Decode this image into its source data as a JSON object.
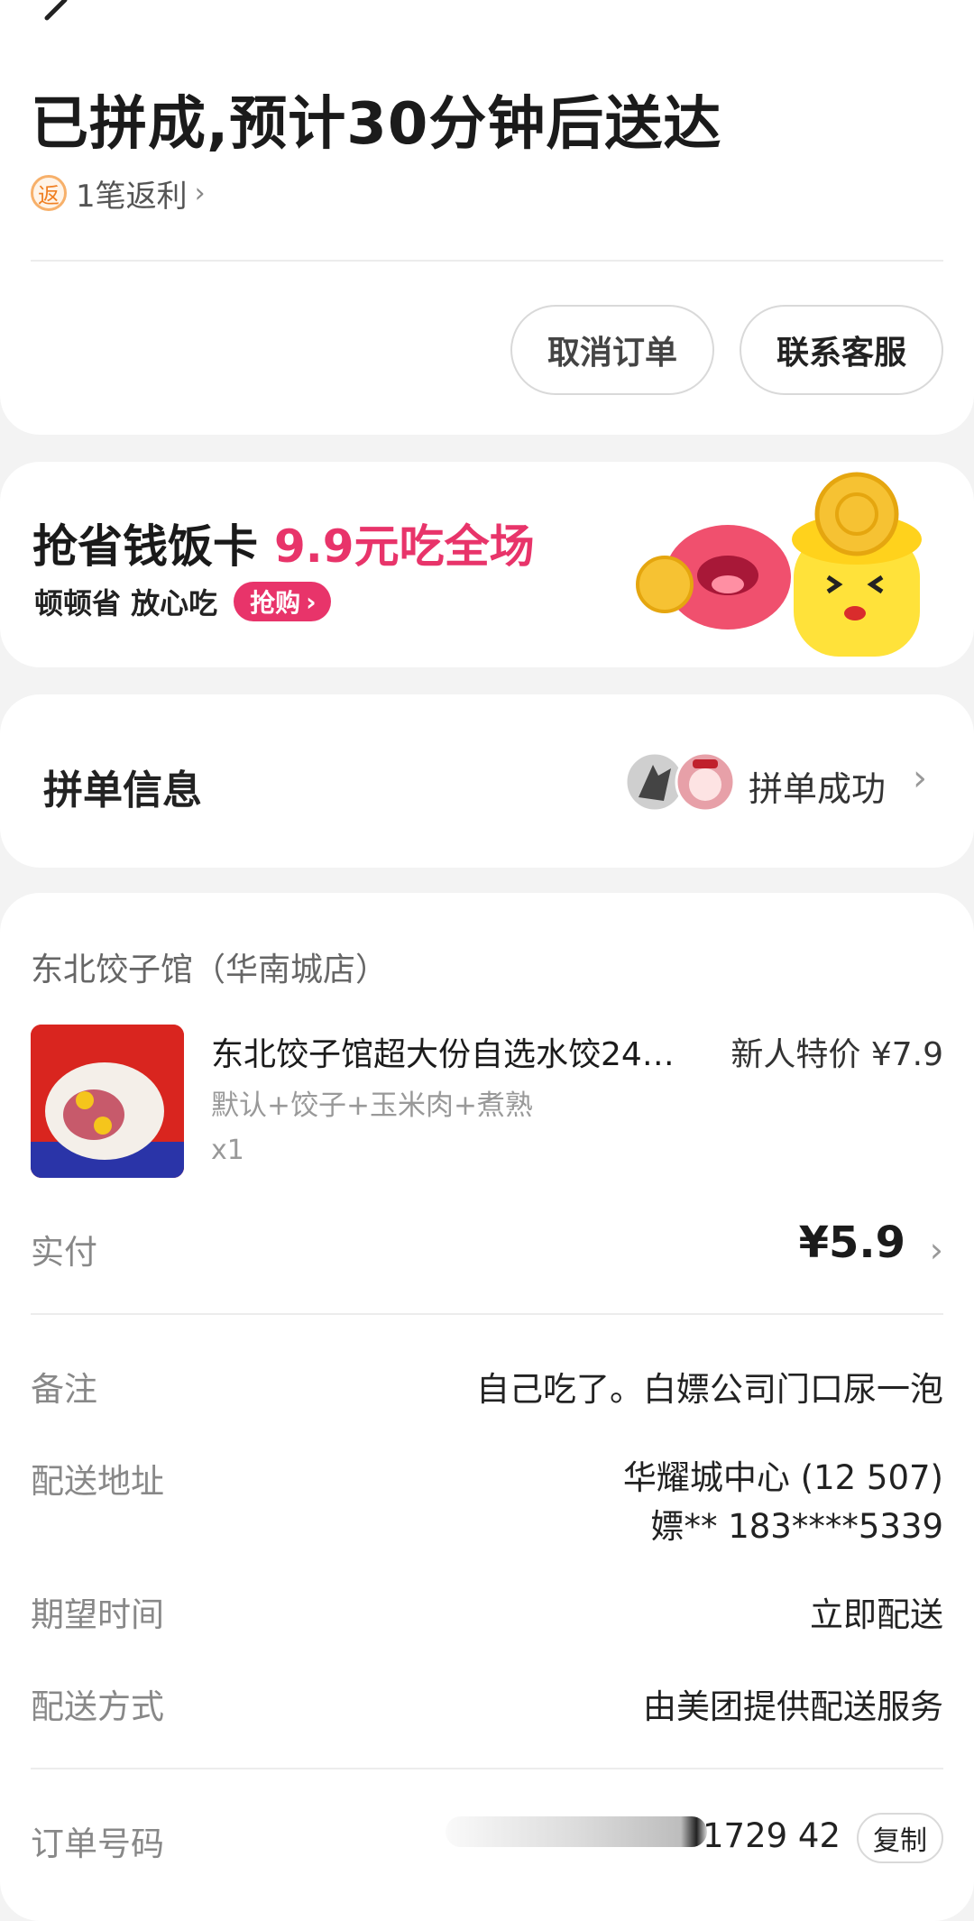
{
  "header": {
    "title": "已拼成,预计30分钟后送达",
    "rebate_icon": "返",
    "rebate_text": "1笔返利"
  },
  "actions": {
    "cancel_label": "取消订单",
    "contact_label": "联系客服"
  },
  "promo": {
    "title": "抢省钱饭卡",
    "highlight": "9.9元吃全场",
    "subtitle": "顿顿省 放心吃",
    "buy_label": "抢购",
    "accent_color": "#e8346a"
  },
  "group": {
    "title": "拼单信息",
    "status": "拼单成功"
  },
  "order": {
    "shop_name": "东北饺子馆（华南城店）",
    "item": {
      "name": "东北饺子馆超大份自选水饺24…",
      "price": "新人特价 ¥7.9",
      "spec": "默认+饺子+玉米肉+煮熟",
      "qty": "x1"
    },
    "paid_label": "实付",
    "paid_value": "¥5.9",
    "remark_label": "备注",
    "remark_value": "自己吃了。白嫖公司门口尿一泡",
    "address_label": "配送地址",
    "address_line1": "华耀城中心 (12 507)",
    "address_line2": "嫖** 183****5339",
    "time_label": "期望时间",
    "time_value": "立即配送",
    "method_label": "配送方式",
    "method_value": "由美团提供配送服务",
    "order_no_label": "订单号码",
    "order_no_value": "1729 42",
    "copy_label": "复制"
  }
}
